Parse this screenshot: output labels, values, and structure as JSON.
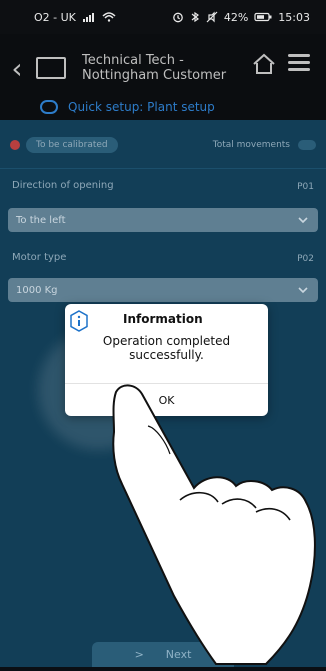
{
  "status_bar": {
    "carrier": "O2 - UK",
    "battery_percent": "42%",
    "time": "15:03"
  },
  "header": {
    "title_line1": "Technical Tech -",
    "title_line2": "Nottingham Customer",
    "subheader": "Quick setup: Plant setup"
  },
  "content": {
    "status_badge": "To be calibrated",
    "status_right_label": "Total movements",
    "direction_label": "Direction of opening",
    "direction_meta": "P01",
    "direction_value": "To the left",
    "motor_label": "Motor type",
    "motor_meta": "P02",
    "motor_value": "1000 Kg"
  },
  "dialog": {
    "title": "Information",
    "message": "Operation completed successfully.",
    "ok_label": "OK"
  },
  "bottom": {
    "next_label": "Next",
    "arrow": ">"
  },
  "colors": {
    "main_bg": "#123e57",
    "accent_blue": "#2d7cc9",
    "dialog_bg": "#ffffff"
  }
}
